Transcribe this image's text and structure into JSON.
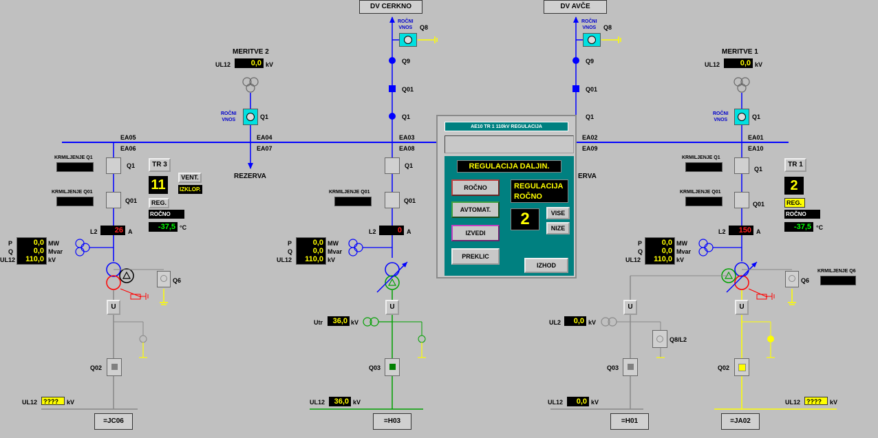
{
  "header": {
    "dv_left": "DV CERKNO",
    "dv_right": "DV AVČE"
  },
  "labels": {
    "rocni": "ROČNI",
    "vnos": "VNOS",
    "meritve2": "MERITVE 2",
    "meritve1": "MERITVE 1",
    "ul12": "UL12",
    "kv": "kV",
    "ea01": "EA01",
    "ea02": "EA02",
    "ea03": "EA03",
    "ea04": "EA04",
    "ea05": "EA05",
    "ea06": "EA06",
    "ea07": "EA07",
    "ea08": "EA08",
    "ea09": "EA09",
    "ea10": "EA10",
    "rezerva": "REZERVA",
    "rezerva_partial": "ERVA",
    "q1": "Q1",
    "q01": "Q01",
    "q8": "Q8",
    "q9": "Q9",
    "q6": "Q6",
    "q02": "Q02",
    "q03": "Q03",
    "q8l2": "Q8/L2",
    "krm_q1": "KRMILJENJE Q1",
    "krm_q01": "KRMILJENJE Q01",
    "krm_q6": "KRMILJENJE Q6",
    "l2": "L2",
    "a": "A",
    "degc": "°C",
    "p": "P",
    "q": "Q",
    "mw": "MW",
    "mvar": "Mvar",
    "u": "U",
    "utr": "Utr",
    "ul2": "UL2"
  },
  "meritve2_value": "0,0",
  "meritve1_value": "0,0",
  "tr3": {
    "label": "TR 3",
    "tap": "11",
    "vent": "VENT.",
    "izklop": "IZKLOP.",
    "reg": "REG.",
    "mode": "ROČNO",
    "temp": "-37,5"
  },
  "tr1": {
    "label": "TR 1",
    "tap": "2",
    "reg": "REG.",
    "mode": "ROČNO",
    "temp": "-37,5"
  },
  "bay_left": {
    "l2": "26",
    "p": "0,0",
    "q": "0,0",
    "ul12": "110,0",
    "bottom_ul12": "????",
    "name": "=JC06"
  },
  "bay_mid": {
    "l2": "0",
    "p": "0,0",
    "q": "0,0",
    "ul12": "110,0",
    "utr": "36,0",
    "bottom_ul12": "36,0",
    "name": "=H03"
  },
  "bay_right": {
    "l2": "150",
    "p": "0,0",
    "q": "0,0",
    "ul12": "110,0",
    "ul2": "0,0",
    "bottom_ul12": "0,0",
    "bottom_ul12_far": "????",
    "name_h01": "=H01",
    "name_ja02": "=JA02"
  },
  "dialog": {
    "title": "AE10 TR 1 110kV   REGULACIJA",
    "header": "REGULACIJA   DALJIN.",
    "status_line1": "REGULACIJA",
    "status_line2": "ROČNO",
    "rocno": "ROČNO",
    "avtomat": "AVTOMAT.",
    "izvedi": "IZVEDI",
    "preklic": "PREKLIC",
    "izhod": "IZHOD",
    "vise": "VISE",
    "nize": "NIZE",
    "tap": "2"
  }
}
